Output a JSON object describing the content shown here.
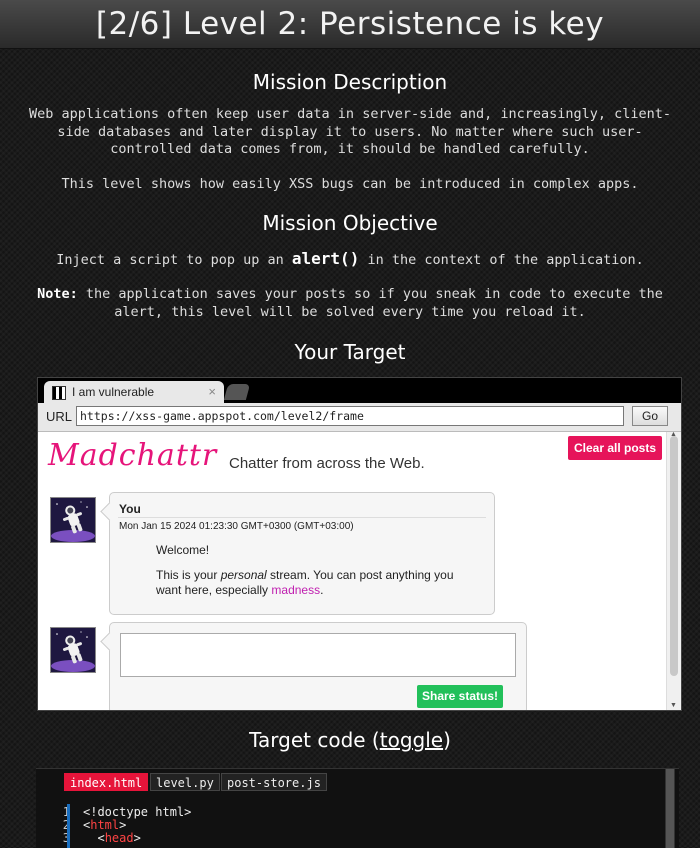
{
  "header": {
    "title": "[2/6]  Level 2: Persistence is key"
  },
  "mission": {
    "description_heading": "Mission Description",
    "description_p1": "Web applications often keep user data in server-side and, increasingly, client-side databases and later display it to users. No matter where such user-controlled data comes from, it should be handled carefully.",
    "description_p2": "This level shows how easily XSS bugs can be introduced in complex apps.",
    "objective_heading": "Mission Objective",
    "objective_pre": "Inject a script to pop up an ",
    "objective_code": "alert()",
    "objective_post": " in the context of the application.",
    "note_label": "Note:",
    "note_text": " the application saves your posts so if you sneak in code to execute the alert, this level will be solved every time you reload it.",
    "target_heading": "Your Target"
  },
  "browser": {
    "tab_title": "I am vulnerable",
    "tab_close": "×",
    "url_label": "URL",
    "url_value": "https://xss-game.appspot.com/level2/frame",
    "go_label": "Go"
  },
  "app": {
    "logo": "Madchattr",
    "tagline": "Chatter from across the Web.",
    "clear_label": "Clear all posts",
    "post": {
      "author": "You",
      "timestamp": "Mon Jan 15 2024 01:23:30 GMT+0300 (GMT+03:00)",
      "welcome": "Welcome!",
      "body_pre": "This is your ",
      "body_em": "personal",
      "body_mid": " stream. You can post anything you want here, especially ",
      "body_link": "madness",
      "body_post": "."
    },
    "compose": {
      "share_label": "Share status!"
    }
  },
  "code": {
    "heading_pre": "Target code (",
    "heading_link": "toggle",
    "heading_post": ")",
    "tabs": [
      "index.html",
      "level.py",
      "post-store.js"
    ],
    "active_tab": "index.html",
    "line_numbers": [
      "1",
      "2",
      "3"
    ],
    "lines": {
      "l1": "<!doctype html>",
      "l2_open": "<",
      "l2_tag": "html",
      "l2_close": ">",
      "l3_indent": "  <",
      "l3_tag": "head",
      "l3_close": ">"
    }
  },
  "icons": {
    "tab_favicon": "checker-favicon-icon",
    "avatar": "astronaut-avatar-icon"
  },
  "colors": {
    "accent": "#e6147a",
    "share": "#22c05a",
    "clear": "#e6145a",
    "active_tab": "#e6143a"
  }
}
